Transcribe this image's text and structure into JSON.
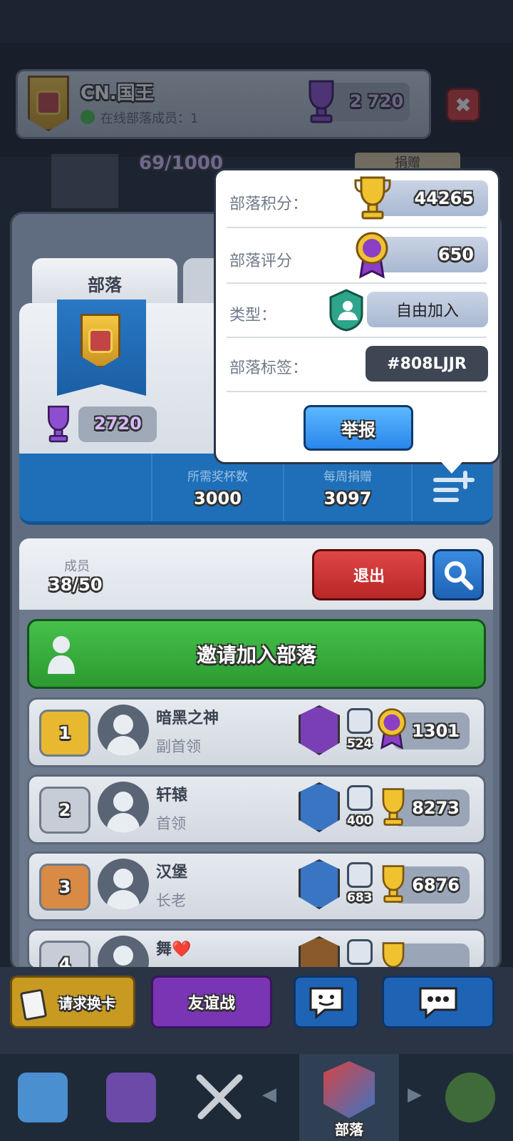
{
  "top_bar": {
    "clan_name": "CN.国王",
    "online_text": "在线部落成员：1",
    "trophies": "2 720",
    "close_icon": "✖"
  },
  "behind": {
    "progress_text": "69/1000",
    "donate_label": "捐赠"
  },
  "tab": {
    "label": "部落"
  },
  "clan_card": {
    "trophies": "2720"
  },
  "stats": {
    "required_trophies_label": "所需奖杯数",
    "required_trophies": "3000",
    "weekly_donations_label": "每周捐赠",
    "weekly_donations": "3097"
  },
  "popup": {
    "clan_score_label": "部落积分：",
    "clan_score": "44265",
    "clan_rating_label": "部落评分",
    "clan_rating": "650",
    "type_label": "类型：",
    "type_value": "自由加入",
    "tag_label": "部落标签：",
    "tag_value": "#808LJJR",
    "report_button": "举报"
  },
  "members": {
    "label": "成员",
    "count": "38/50",
    "exit_button": "退出",
    "invite_button": "邀请加入部落",
    "list": [
      {
        "rank": "1",
        "name": "暗黑之神",
        "role": "副首领",
        "donations": "524",
        "score": "1301",
        "rank_color": "#e8b930",
        "arena_color": "#7b3fb5",
        "score_icon": "ribbon-icon"
      },
      {
        "rank": "2",
        "name": "轩辕",
        "role": "首领",
        "donations": "400",
        "score": "8273",
        "rank_color": "#c7cdd6",
        "arena_color": "#3a75c4",
        "score_icon": "trophy-icon"
      },
      {
        "rank": "3",
        "name": "汉堡",
        "role": "长老",
        "donations": "683",
        "score": "6876",
        "rank_color": "#d98a45",
        "arena_color": "#3a75c4",
        "score_icon": "trophy-icon"
      },
      {
        "rank": "4",
        "name": "舞❤️",
        "role": "",
        "donations": "",
        "score": "",
        "rank_color": "#c7cdd6",
        "arena_color": "#8a5a2a",
        "score_icon": "trophy-icon"
      }
    ]
  },
  "bottom_actions": {
    "request_card": "请求换卡",
    "friendly_battle": "友谊战"
  },
  "nav": {
    "active_label": "部落"
  },
  "colors": {
    "gold": "#f0c230",
    "blue": "#1f6fb8",
    "green": "#3bb03f",
    "red": "#d13737",
    "purple": "#8a3fc4"
  }
}
